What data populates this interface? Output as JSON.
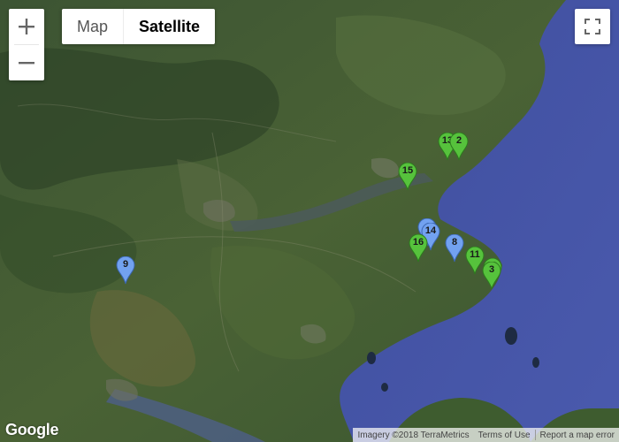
{
  "map": {
    "type_control": {
      "map_label": "Map",
      "satellite_label": "Satellite",
      "selected": "Satellite"
    },
    "zoom": {
      "in_icon": "plus-icon",
      "out_icon": "minus-icon"
    },
    "fullscreen_icon": "fullscreen-icon",
    "colors": {
      "green_marker": "#56c23c",
      "blue_marker": "#72a2f0",
      "water": "#4a57a8",
      "land": "#3e5a2e"
    },
    "markers": [
      {
        "label": "13",
        "color": "green"
      },
      {
        "label": "2",
        "color": "green"
      },
      {
        "label": "15",
        "color": "green"
      },
      {
        "label": "",
        "color": "blue"
      },
      {
        "label": "14",
        "color": "blue"
      },
      {
        "label": "16",
        "color": "green"
      },
      {
        "label": "8",
        "color": "blue"
      },
      {
        "label": "11",
        "color": "green"
      },
      {
        "label": "",
        "color": "green"
      },
      {
        "label": "3",
        "color": "green"
      },
      {
        "label": "9",
        "color": "blue"
      }
    ],
    "logo": "Google",
    "attribution": {
      "imagery": "Imagery ©2018 TerraMetrics",
      "terms": "Terms of Use",
      "report": "Report a map error"
    }
  }
}
